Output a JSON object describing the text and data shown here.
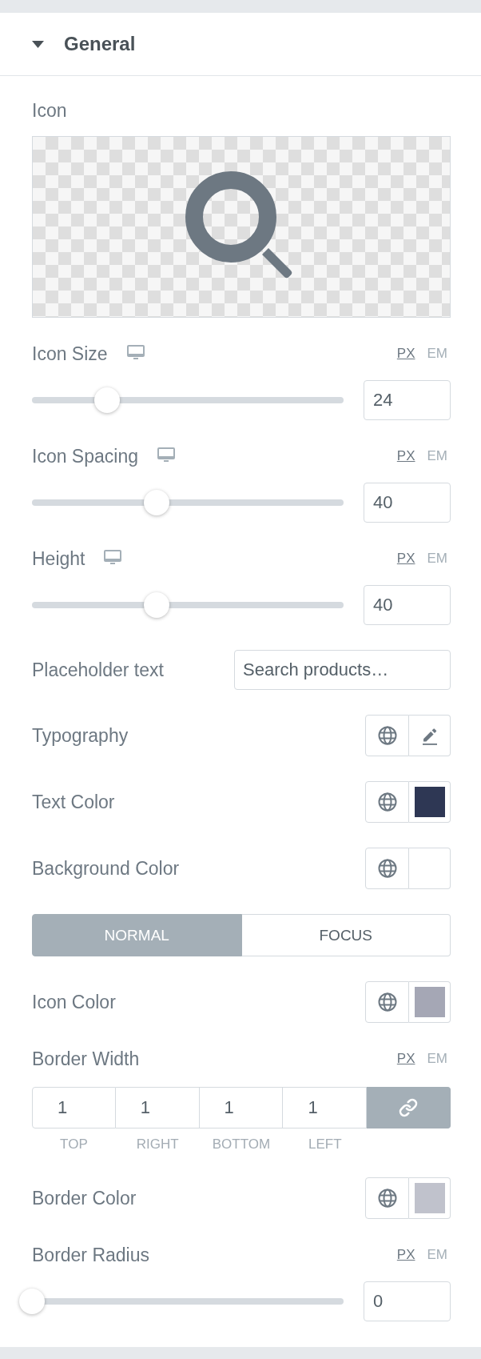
{
  "section": {
    "title": "General",
    "expanded": true
  },
  "controls": [
    {
      "kind": "icon",
      "label": "Icon"
    },
    {
      "kind": "slider",
      "label": "Icon Size",
      "responsive": true,
      "units": [
        {
          "label": "PX",
          "selected": true
        },
        {
          "label": "EM",
          "selected": false
        }
      ],
      "level": 0.24,
      "value": "24"
    },
    {
      "kind": "slider",
      "label": "Icon Spacing",
      "responsive": true,
      "units": [
        {
          "label": "PX",
          "selected": true
        },
        {
          "label": "EM",
          "selected": false
        }
      ],
      "level": 0.4,
      "value": "40"
    },
    {
      "kind": "slider",
      "label": "Height",
      "responsive": true,
      "units": [
        {
          "label": "PX",
          "selected": true
        },
        {
          "label": "EM",
          "selected": false
        }
      ],
      "level": 0.4,
      "value": "40"
    },
    {
      "kind": "text",
      "label": "Placeholder text",
      "value": "Search products…"
    },
    {
      "kind": "typography",
      "label": "Typography"
    },
    {
      "kind": "color",
      "label": "Text Color",
      "color": "#2e3754"
    },
    {
      "kind": "color",
      "label": "Background Color"
    },
    {
      "kind": "tabs",
      "tabs": [
        {
          "label": "NORMAL",
          "selected": true
        },
        {
          "label": "FOCUS",
          "selected": false
        }
      ]
    },
    {
      "kind": "color",
      "label": "Icon Color",
      "color": "#a5a7b5"
    },
    {
      "kind": "dimensions",
      "label": "Border Width",
      "responsive": false,
      "units": [
        {
          "label": "PX",
          "selected": true
        },
        {
          "label": "EM",
          "selected": false
        }
      ],
      "fields": [
        {
          "value": "1",
          "caption": "TOP"
        },
        {
          "value": "1",
          "caption": "RIGHT"
        },
        {
          "value": "1",
          "caption": "BOTTOM"
        },
        {
          "value": "1",
          "caption": "LEFT"
        }
      ],
      "linked": true
    },
    {
      "kind": "color",
      "label": "Border Color",
      "color": "#c0c2cc"
    },
    {
      "kind": "slider",
      "label": "Border Radius",
      "responsive": false,
      "units": [
        {
          "label": "PX",
          "selected": true
        },
        {
          "label": "EM",
          "selected": false
        }
      ],
      "level": 0,
      "value": "0"
    }
  ]
}
